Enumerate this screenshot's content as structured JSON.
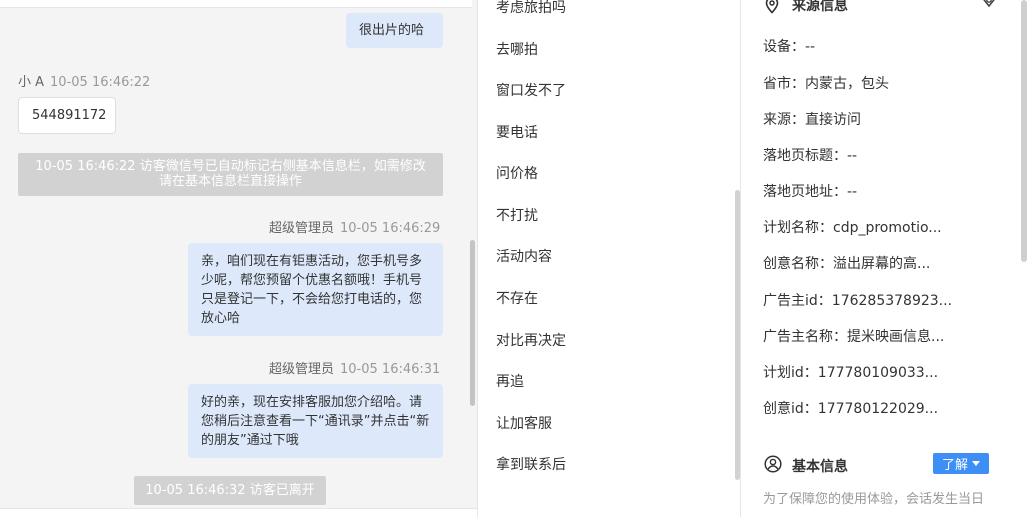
{
  "chat": {
    "messages": [
      {
        "type": "agent_text",
        "text": "很出片的哈"
      },
      {
        "type": "visitor",
        "sender": "小 A",
        "time": "10-05 16:46:22",
        "text": "544891172"
      },
      {
        "type": "system",
        "text": "10-05 16:46:22 访客微信号已自动标记右侧基本信息栏，如需修改请在基本信息栏直接操作"
      },
      {
        "type": "agent",
        "sender": "超级管理员",
        "time": "10-05 16:46:29",
        "text": "亲，咱们现在有钜惠活动，您手机号多少呢，帮您预留个优惠名额哦！手机号只是登记一下，不会给您打电话的，您放心哈"
      },
      {
        "type": "agent",
        "sender": "超级管理员",
        "time": "10-05 16:46:31",
        "text": "好的亲，现在安排客服加您介绍哈。请您稍后注意查看一下“通讯录”并点击“新的朋友”通过下哦"
      },
      {
        "type": "system",
        "text": "10-05 16:46:32 访客已离开"
      }
    ]
  },
  "quick_replies": [
    "考虑旅拍吗",
    "去哪拍",
    "窗口发不了",
    "要电话",
    "问价格",
    "不打扰",
    "活动内容",
    "不存在",
    "对比再决定",
    "再追",
    "让加客服",
    "拿到联系后"
  ],
  "source_info": {
    "title": "来源信息",
    "rows": [
      {
        "label": "设备：",
        "value": "--"
      },
      {
        "label": "省市：",
        "value": "内蒙古，包头"
      },
      {
        "label": "来源：",
        "value": "直接访问"
      },
      {
        "label": "落地页标题：",
        "value": "--"
      },
      {
        "label": "落地页地址：",
        "value": "--"
      },
      {
        "label": "计划名称：",
        "value": "cdp_promotio..."
      },
      {
        "label": "创意名称：",
        "value": "溢出屏幕的高..."
      },
      {
        "label": "广告主id：",
        "value": "176285378923..."
      },
      {
        "label": "广告主名称：",
        "value": "提米映画信息..."
      },
      {
        "label": "计划id：",
        "value": "177780109033..."
      },
      {
        "label": "创意id：",
        "value": "177780122029..."
      }
    ]
  },
  "basic_info": {
    "title": "基本信息",
    "learn_button": "了解",
    "notice": "为了保障您的使用体验，会话发生当日"
  },
  "icons": {
    "source": "location-pin-icon",
    "basic": "user-circle-icon",
    "edit": "edit-icon",
    "caret": "caret-down-icon"
  }
}
